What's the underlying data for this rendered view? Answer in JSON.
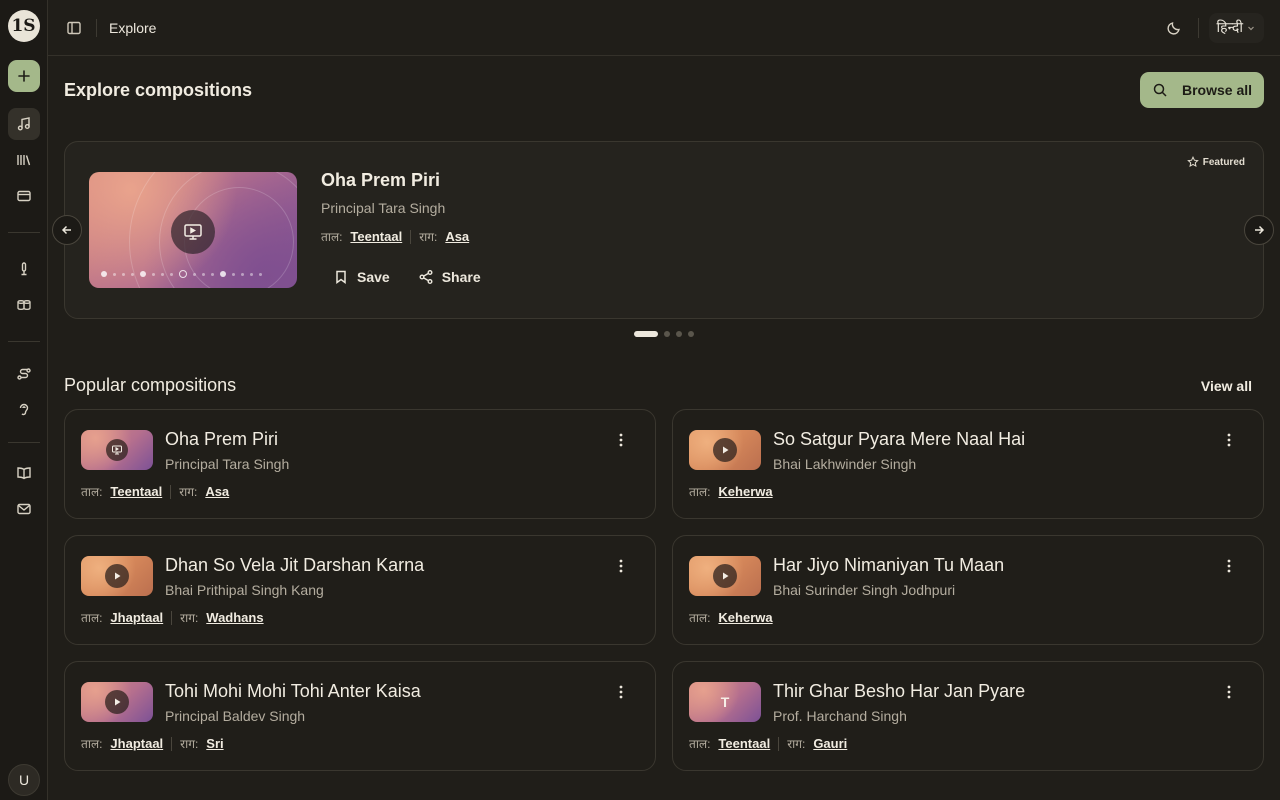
{
  "sidebar": {
    "logo_text": "1S",
    "avatar_initial": "U",
    "items": [
      {
        "icon": "music-note-icon"
      },
      {
        "icon": "library-icon"
      },
      {
        "icon": "card-icon"
      },
      {
        "icon": "microphone-icon"
      },
      {
        "icon": "tabla-icon"
      },
      {
        "icon": "route-icon"
      },
      {
        "icon": "ear-icon"
      },
      {
        "icon": "book-open-icon"
      },
      {
        "icon": "mail-icon"
      }
    ]
  },
  "topbar": {
    "breadcrumb": "Explore",
    "language": "हिन्दी"
  },
  "page": {
    "title": "Explore compositions",
    "browse_label": "Browse all"
  },
  "featured": {
    "badge": "Featured",
    "title": "Oha Prem Piri",
    "artist": "Principal Tara Singh",
    "taal_label": "ताल:",
    "taal": "Teentaal",
    "raag_label": "राग:",
    "raag": "Asa",
    "save_label": "Save",
    "share_label": "Share",
    "pages": 4,
    "active_page": 1
  },
  "popular": {
    "title": "Popular compositions",
    "view_all": "View all",
    "cards": [
      {
        "title": "Oha Prem Piri",
        "artist": "Principal Tara Singh",
        "taal_label": "ताल:",
        "taal": "Teentaal",
        "raag_label": "राग:",
        "raag": "Asa",
        "thumb": "pink",
        "thumb_icon": "video-play-icon"
      },
      {
        "title": "So Satgur Pyara Mere Naal Hai",
        "artist": "Bhai Lakhwinder Singh",
        "taal_label": "ताल:",
        "taal": "Keherwa",
        "thumb": "orange",
        "thumb_icon": "play-icon"
      },
      {
        "title": "Dhan So Vela Jit Darshan Karna",
        "artist": "Bhai Prithipal Singh Kang",
        "taal_label": "ताल:",
        "taal": "Jhaptaal",
        "raag_label": "राग:",
        "raag": "Wadhans",
        "thumb": "orange",
        "thumb_icon": "play-icon"
      },
      {
        "title": "Har Jiyo Nimaniyan Tu Maan",
        "artist": "Bhai Surinder Singh Jodhpuri",
        "taal_label": "ताल:",
        "taal": "Keherwa",
        "thumb": "orange",
        "thumb_icon": "play-icon"
      },
      {
        "title": "Tohi Mohi Mohi Tohi Anter Kaisa",
        "artist": "Principal Baldev Singh",
        "taal_label": "ताल:",
        "taal": "Jhaptaal",
        "raag_label": "राग:",
        "raag": "Sri",
        "thumb": "pink",
        "thumb_icon": "play-icon"
      },
      {
        "title": "Thir Ghar Besho Har Jan Pyare",
        "artist": "Prof. Harchand Singh",
        "taal_label": "ताल:",
        "taal": "Teentaal",
        "raag_label": "राग:",
        "raag": "Gauri",
        "thumb": "pink",
        "thumb_letter": "T"
      }
    ]
  },
  "colors": {
    "background": "#201e19",
    "accent": "#a4b88a",
    "text": "#ece7dc",
    "muted": "#b4ad9f"
  }
}
